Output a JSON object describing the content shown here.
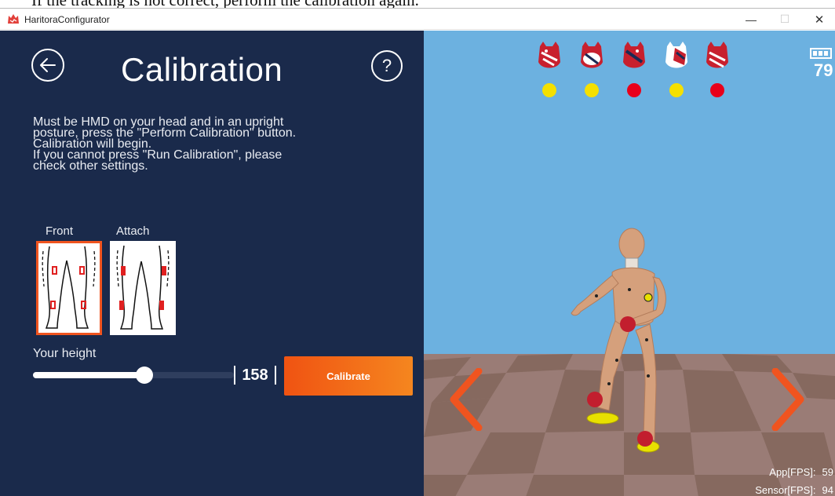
{
  "caption": "If the tracking is not correct, perform the calibration again.",
  "window": {
    "title": "HaritoraConfigurator",
    "minimize": "—",
    "maximize": "☐",
    "close": "✕"
  },
  "panel": {
    "title": "Calibration",
    "help": "?",
    "instructions": [
      "Must be HMD on your head and in an upright",
      "posture, press the \"Perform Calibration\" button.",
      "Calibration will begin.",
      "If you cannot press \"Run Calibration\", please",
      "check other settings."
    ],
    "modes": [
      {
        "label": "Front",
        "selected": true
      },
      {
        "label": "Attach",
        "selected": false
      }
    ],
    "height_label": "Your height",
    "height_value": "158",
    "height_slider_fraction": 0.56,
    "calibrate_label": "Calibrate"
  },
  "scene": {
    "battery": "79",
    "trackers": [
      {
        "icon": "tracker-cat-icon",
        "status_color": "#f5e000"
      },
      {
        "icon": "tracker-cat-icon",
        "status_color": "#f5e000"
      },
      {
        "icon": "tracker-cat-icon",
        "status_color": "#e8001a"
      },
      {
        "icon": "tracker-cat-icon",
        "status_color": "#f5e000"
      },
      {
        "icon": "tracker-cat-icon",
        "status_color": "#e8001a"
      }
    ],
    "fps_app_label": "App[FPS]:",
    "fps_app_value": "59",
    "fps_sensor_label": "Sensor[FPS]:",
    "fps_sensor_value": "94"
  },
  "colors": {
    "panel_bg": "#1a2a4b",
    "accent": "#f0541f",
    "sky": "#6cb1e0",
    "floor": "#9a7c76"
  }
}
